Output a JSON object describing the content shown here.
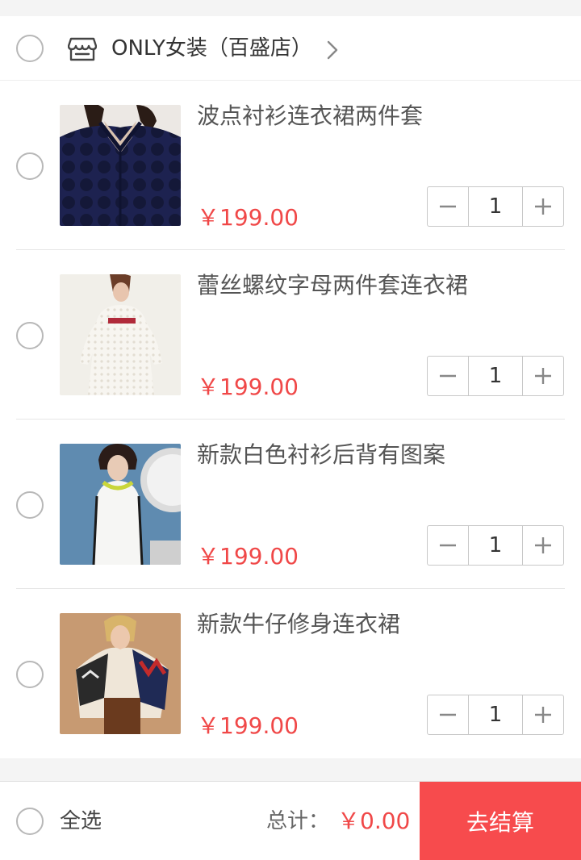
{
  "shop": {
    "name": "ONLY女装（百盛店）",
    "icon": "store-icon"
  },
  "items": [
    {
      "title": "波点衬衫连衣裙两件套",
      "price": "￥199.00",
      "quantity": "1",
      "image": "navy-polka-dot-dress"
    },
    {
      "title": "蕾丝螺纹字母两件套连衣裙",
      "price": "￥199.00",
      "quantity": "1",
      "image": "white-lace-dress"
    },
    {
      "title": "新款白色衬衫后背有图案",
      "price": "￥199.00",
      "quantity": "1",
      "image": "white-sleeveless-shirt"
    },
    {
      "title": "新款牛仔修身连衣裙",
      "price": "￥199.00",
      "quantity": "1",
      "image": "patterned-poncho-outfit"
    }
  ],
  "footer": {
    "select_all_label": "全选",
    "total_label": "总计：",
    "total_value": "￥0.00",
    "checkout_label": "去结算"
  },
  "colors": {
    "accent": "#f74b4d",
    "price": "#f04848",
    "background": "#f4f4f4"
  }
}
